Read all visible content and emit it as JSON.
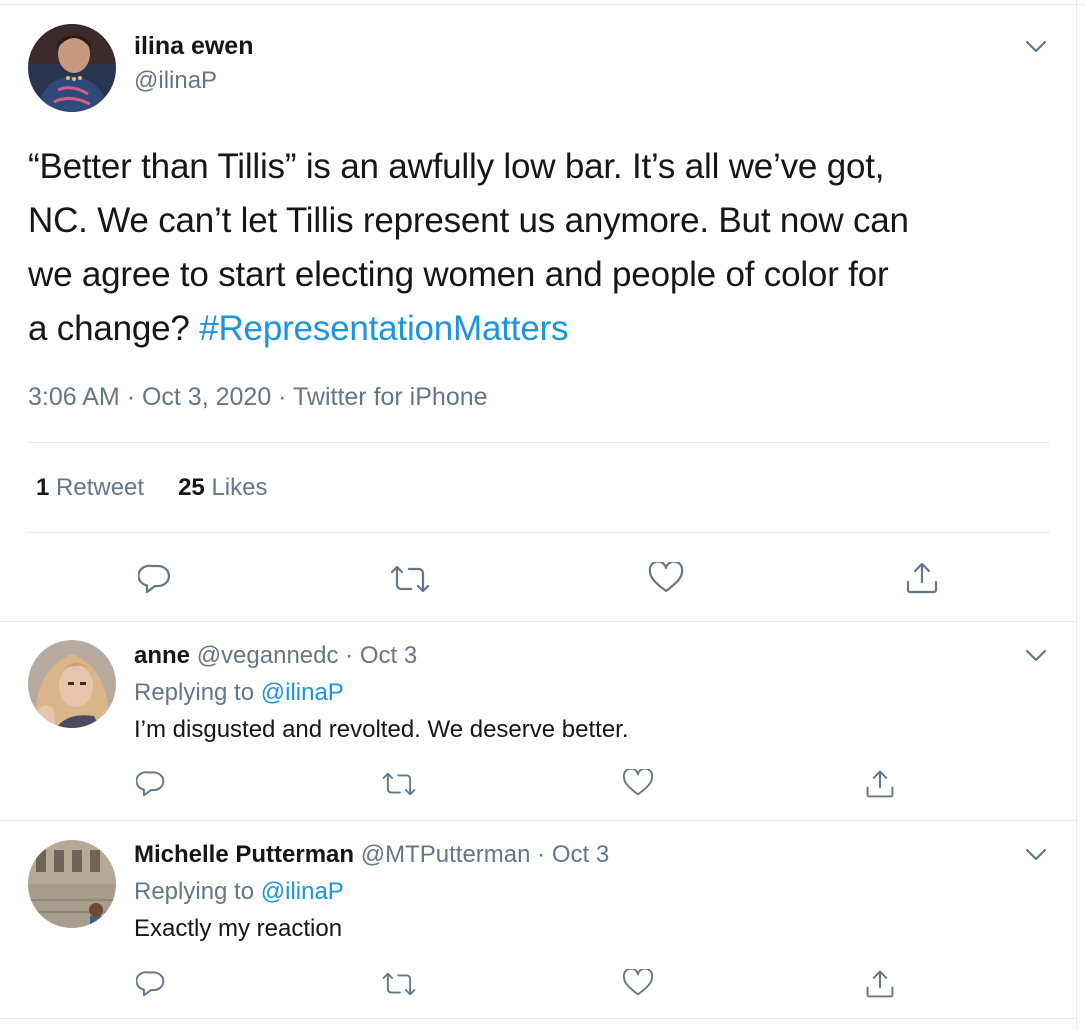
{
  "tweet": {
    "author_name": "ilina ewen",
    "author_handle": "@ilinaP",
    "text_parts": {
      "l1": "“Better than Tillis” is an awfully low bar. It’s all we’ve got,",
      "l2": "NC. We can’t let Tillis represent us anymore. But now can",
      "l3": "we agree to start electing women and people of color for",
      "l4": "a change? ",
      "hashtag": "#RepresentationMatters"
    },
    "time": "3:06 AM",
    "date": "Oct 3, 2020",
    "source": "Twitter for iPhone",
    "retweets_count": "1",
    "retweets_label": "Retweet",
    "likes_count": "25",
    "likes_label": "Likes"
  },
  "replies": [
    {
      "name": "anne",
      "handle": "@vegannedc",
      "date": "Oct 3",
      "replying_prefix": "Replying to",
      "replying_to": "@ilinaP",
      "text": "I’m disgusted and revolted. We deserve better."
    },
    {
      "name": "Michelle Putterman",
      "handle": "@MTPutterman",
      "date": "Oct 3",
      "replying_prefix": "Replying to",
      "replying_to": "@ilinaP",
      "text": "Exactly my reaction"
    }
  ],
  "separator": "·",
  "icons": [
    "reply-icon",
    "retweet-icon",
    "like-icon",
    "share-icon",
    "chevron-down-icon"
  ],
  "colors": {
    "link": "#1b95e0",
    "muted": "#657786",
    "text": "#14171a",
    "divider": "#e6ecf0"
  }
}
